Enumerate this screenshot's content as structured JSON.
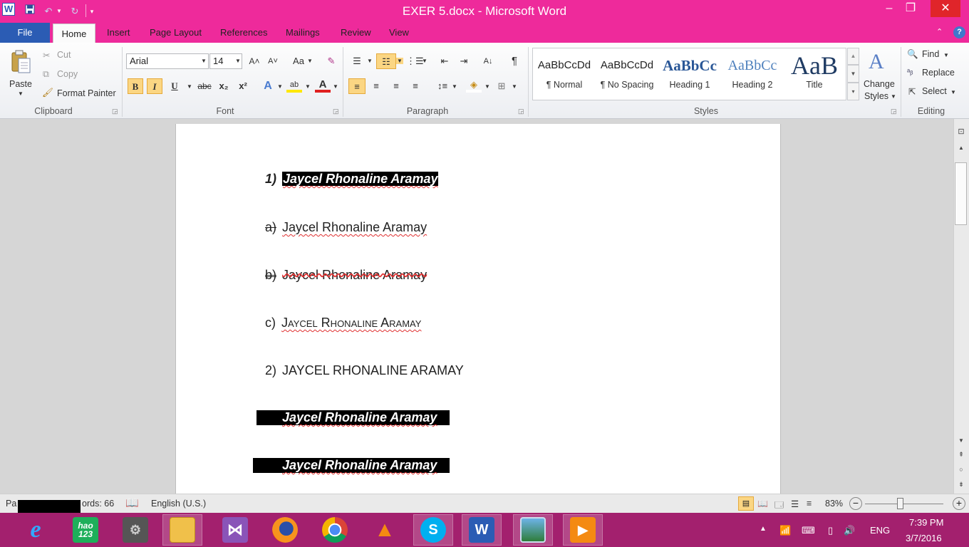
{
  "window": {
    "title": "EXER 5.docx - Microsoft Word"
  },
  "quick_access": {
    "word_icon": "W",
    "save_icon": "save-icon",
    "undo_icon": "undo-icon",
    "redo_icon": "redo-icon"
  },
  "tabs": [
    "File",
    "Home",
    "Insert",
    "Page Layout",
    "References",
    "Mailings",
    "Review",
    "View"
  ],
  "clipboard": {
    "paste": "Paste",
    "cut": "Cut",
    "copy": "Copy",
    "format_painter": "Format Painter",
    "group": "Clipboard"
  },
  "font": {
    "family": "Arial",
    "size": "14",
    "group": "Font",
    "bold": "B",
    "italic": "I",
    "underline": "U",
    "strike": "abc",
    "sub": "x₂",
    "sup": "x²",
    "grow": "A˄",
    "shrink": "A˅",
    "case": "Aa",
    "color_letter": "A",
    "highlight_letters": "ab"
  },
  "paragraph": {
    "group": "Paragraph",
    "pilcrow": "¶"
  },
  "styles": {
    "group": "Styles",
    "items": [
      {
        "preview": "AaBbCcDd",
        "name": "¶ Normal"
      },
      {
        "preview": "AaBbCcDd",
        "name": "¶ No Spacing"
      },
      {
        "preview": "AaBbCc",
        "name": "Heading 1"
      },
      {
        "preview": "AaBbCc",
        "name": "Heading 2"
      },
      {
        "preview": "AaB",
        "name": "Title"
      }
    ],
    "change_styles_1": "Change",
    "change_styles_2": "Styles"
  },
  "editing": {
    "group": "Editing",
    "find": "Find",
    "replace": "Replace",
    "select": "Select"
  },
  "document": {
    "lines": [
      {
        "marker": "1)",
        "text": "Jaycel Rhonaline Aramay"
      },
      {
        "marker": "a)",
        "text": "Jaycel Rhonaline Aramay"
      },
      {
        "marker": "b)",
        "text": "Jaycel Rhonaline Aramay"
      },
      {
        "marker": "c)",
        "text": "Jaycel Rhonaline Aramay"
      },
      {
        "marker": "2)",
        "text": "JAYCEL RHONALINE ARAMAY"
      },
      {
        "marker": "",
        "text": "Jaycel Rhonaline Aramay"
      },
      {
        "marker": "",
        "text": "Jaycel Rhonaline Aramay"
      }
    ]
  },
  "status": {
    "page": "Pa",
    "words": "ords: 66",
    "language": "English (U.S.)",
    "zoom": "83%"
  },
  "taskbar": {
    "hao": "hao\n123",
    "word": "W"
  },
  "tray": {
    "lang": "ENG",
    "time": "7:39 PM",
    "date": "3/7/2016"
  },
  "colors": {
    "titlebar": "#ee2a9b",
    "file_tab": "#2b5cb4",
    "taskbar": "#a3206e",
    "close": "#e0252a"
  }
}
